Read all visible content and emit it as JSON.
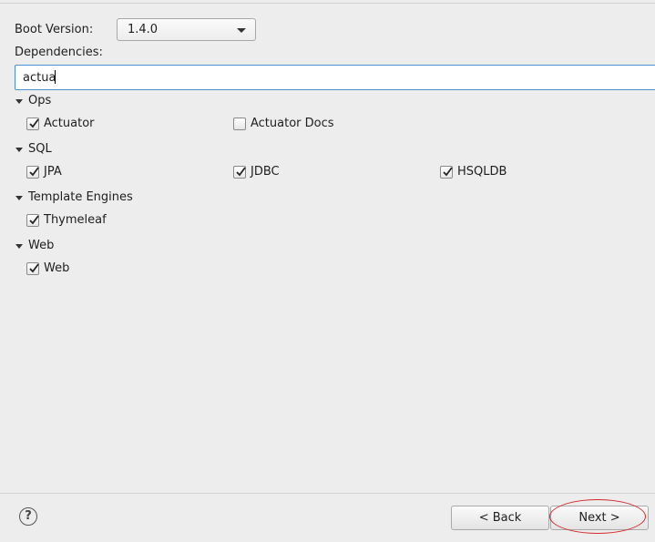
{
  "boot_version": {
    "label": "Boot Version:",
    "value": "1.4.0"
  },
  "dependencies": {
    "label": "Dependencies:",
    "search_value": "actua"
  },
  "groups": [
    {
      "name": "Ops",
      "items": [
        {
          "label": "Actuator",
          "checked": true
        },
        {
          "label": "Actuator Docs",
          "checked": false
        }
      ]
    },
    {
      "name": "SQL",
      "items": [
        {
          "label": "JPA",
          "checked": true
        },
        {
          "label": "JDBC",
          "checked": true
        },
        {
          "label": "HSQLDB",
          "checked": true
        }
      ]
    },
    {
      "name": "Template Engines",
      "items": [
        {
          "label": "Thymeleaf",
          "checked": true
        }
      ]
    },
    {
      "name": "Web",
      "items": [
        {
          "label": "Web",
          "checked": true
        }
      ]
    }
  ],
  "footer": {
    "help_symbol": "?",
    "back_label": "< Back",
    "next_label": "Next >"
  },
  "colors": {
    "annotation": "#d42a2a",
    "focus": "#4a8fd0"
  }
}
